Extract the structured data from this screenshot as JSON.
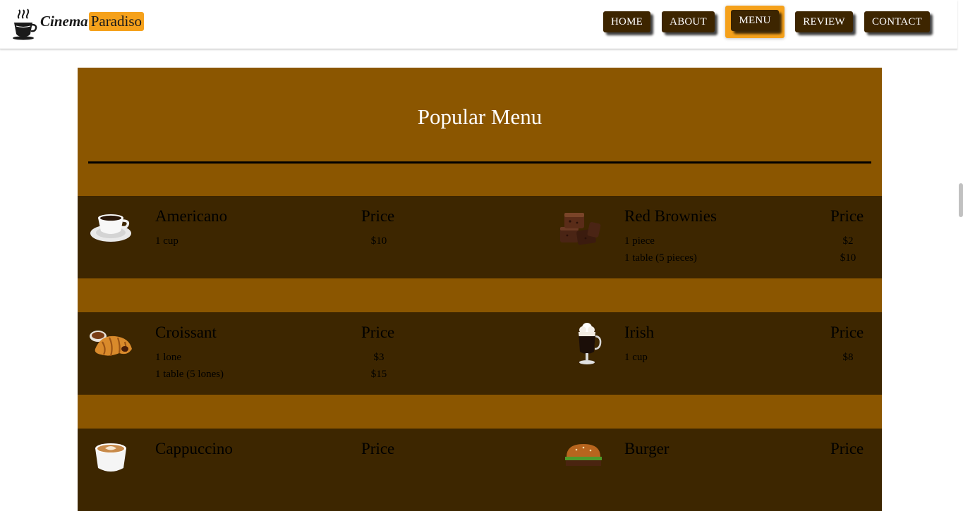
{
  "brand": {
    "word1": "Cinema",
    "word2": "Paradiso",
    "accent": "#f5a11b",
    "dark": "#3d2500"
  },
  "nav": [
    {
      "label": "HOME",
      "active": false
    },
    {
      "label": "ABOUT",
      "active": false
    },
    {
      "label": "MENU",
      "active": true
    },
    {
      "label": "REVIEW",
      "active": false
    },
    {
      "label": "CONTACT",
      "active": false
    }
  ],
  "menu": {
    "title": "Popular Menu",
    "section_color": "#8b5600",
    "band_color": "#3d2600",
    "items": [
      {
        "name": "Americano",
        "price_header": "Price",
        "icon": "coffee-cup-icon",
        "lines": [
          {
            "desc": "1 cup",
            "price": "$10"
          }
        ]
      },
      {
        "name": "Red Brownies",
        "price_header": "Price",
        "icon": "brownies-icon",
        "lines": [
          {
            "desc": "1 piece",
            "price": "$2"
          },
          {
            "desc": "1 table (5 pieces)",
            "price": "$10"
          }
        ]
      },
      {
        "name": "Croissant",
        "price_header": "Price",
        "icon": "croissant-icon",
        "lines": [
          {
            "desc": "1 lone",
            "price": "$3"
          },
          {
            "desc": "1 table (5 lones)",
            "price": "$15"
          }
        ]
      },
      {
        "name": "Irish",
        "price_header": "Price",
        "icon": "irish-coffee-icon",
        "lines": [
          {
            "desc": "1 cup",
            "price": "$8"
          }
        ]
      },
      {
        "name": "Cappuccino",
        "price_header": "Price",
        "icon": "cappuccino-icon",
        "lines": []
      },
      {
        "name": "Burger",
        "price_header": "Price",
        "icon": "burger-icon",
        "lines": []
      }
    ]
  }
}
